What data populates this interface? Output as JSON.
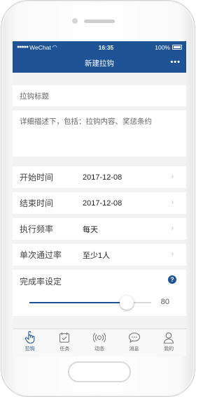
{
  "status_bar": {
    "carrier": "WeChat",
    "time": "16:35",
    "battery": "100%"
  },
  "nav": {
    "title": "新建拉钩",
    "more": "•••"
  },
  "form": {
    "title_placeholder": "拉钩标题",
    "description_placeholder": "详细描述下，包括：拉钩内容、奖惩条约",
    "rows": [
      {
        "label": "开始时间",
        "value": "2017-12-08"
      },
      {
        "label": "结束时间",
        "value": "2017-12-08"
      },
      {
        "label": "执行频率",
        "value": "每天"
      },
      {
        "label": "单次通过率",
        "value": "至少1人"
      }
    ],
    "completion": {
      "label": "完成率设定",
      "value": 80,
      "value_text": "80"
    }
  },
  "tabs": [
    {
      "label": "拉钩",
      "icon": "hand-pointer-icon",
      "active": true
    },
    {
      "label": "任务",
      "icon": "calendar-check-icon",
      "active": false
    },
    {
      "label": "动态",
      "icon": "broadcast-icon",
      "active": false
    },
    {
      "label": "消息",
      "icon": "chat-bubble-icon",
      "active": false
    },
    {
      "label": "我的",
      "icon": "person-icon",
      "active": false
    }
  ],
  "colors": {
    "accent": "#1e5496",
    "background": "#f2f2f2"
  }
}
